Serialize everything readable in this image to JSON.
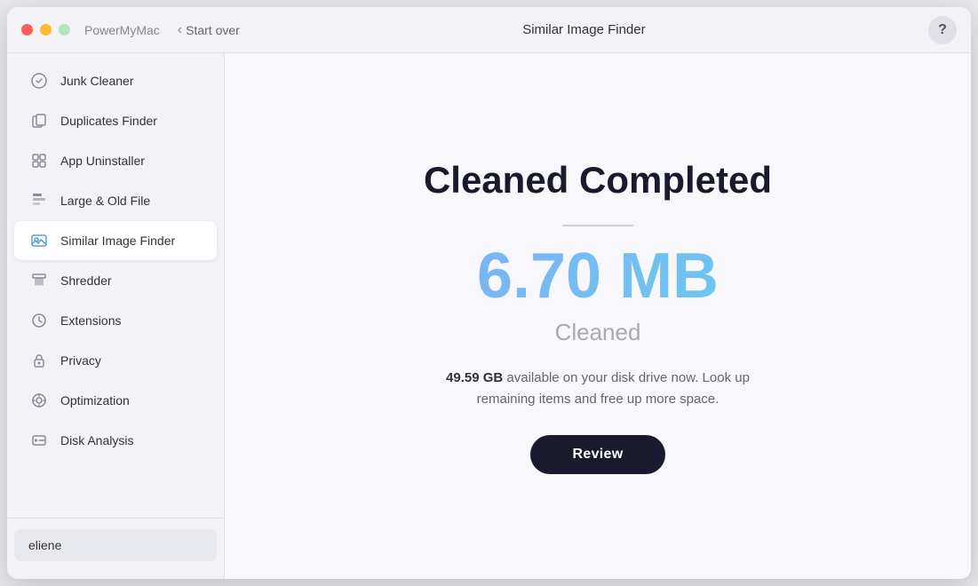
{
  "window": {
    "app_name": "PowerMyMac",
    "title": "Similar Image Finder",
    "start_over_label": "Start over"
  },
  "help_button_label": "?",
  "sidebar": {
    "items": [
      {
        "id": "junk-cleaner",
        "label": "Junk Cleaner",
        "icon": "🔄",
        "active": false
      },
      {
        "id": "duplicates-finder",
        "label": "Duplicates Finder",
        "icon": "📁",
        "active": false
      },
      {
        "id": "app-uninstaller",
        "label": "App Uninstaller",
        "icon": "🗂",
        "active": false
      },
      {
        "id": "large-old-file",
        "label": "Large & Old File",
        "icon": "🗃",
        "active": false
      },
      {
        "id": "similar-image-finder",
        "label": "Similar Image Finder",
        "icon": "🖼",
        "active": true
      },
      {
        "id": "shredder",
        "label": "Shredder",
        "icon": "📋",
        "active": false
      },
      {
        "id": "extensions",
        "label": "Extensions",
        "icon": "🔌",
        "active": false
      },
      {
        "id": "privacy",
        "label": "Privacy",
        "icon": "🔒",
        "active": false
      },
      {
        "id": "optimization",
        "label": "Optimization",
        "icon": "⚙️",
        "active": false
      },
      {
        "id": "disk-analysis",
        "label": "Disk Analysis",
        "icon": "💾",
        "active": false
      }
    ],
    "user_label": "eliene"
  },
  "main": {
    "cleaned_title": "Cleaned Completed",
    "amount": "6.70 MB",
    "cleaned_label": "Cleaned",
    "info_bold": "49.59 GB",
    "info_text": " available on your disk drive now. Look up remaining items and free up more space.",
    "review_button": "Review"
  }
}
